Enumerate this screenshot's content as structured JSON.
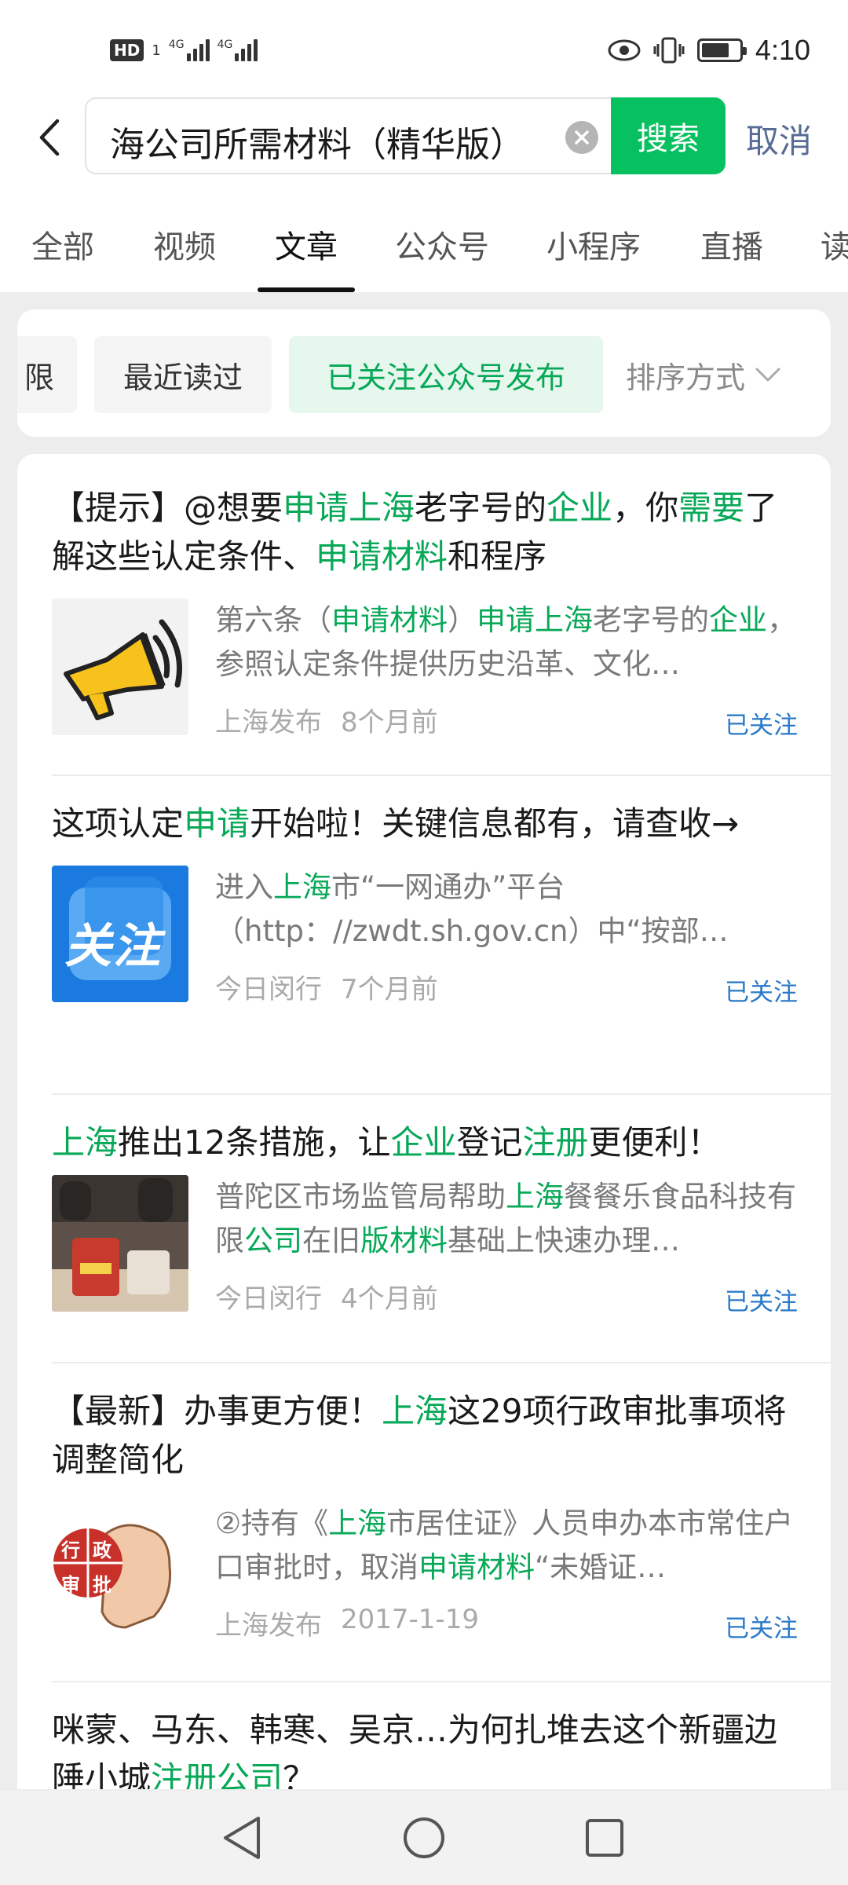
{
  "status_bar": {
    "badge": "HD",
    "sim": "1",
    "net1": "4G",
    "net2": "4G",
    "time": "4:10",
    "battery_level": 0.75
  },
  "search": {
    "query": "海公司所需材料（精华版）",
    "search_label": "搜索",
    "cancel_label": "取消"
  },
  "tabs": [
    "全部",
    "视频",
    "文章",
    "公众号",
    "小程序",
    "直播",
    "读"
  ],
  "active_tab": "文章",
  "filters": {
    "chip_partial": "限",
    "chip_recent": "最近读过",
    "chip_followed": "已关注公众号发布",
    "sort_label": "排序方式"
  },
  "results": [
    {
      "title_parts": [
        "【提示】@想要",
        "申请上海",
        "老字号的",
        "企业",
        "，你",
        "需要",
        "了解这些认定条件、",
        "申请材料",
        "和程序"
      ],
      "snippet_parts": [
        "第六条（",
        "申请材料",
        "）",
        "申请上海",
        "老字号的",
        "企业",
        "，参照认定条件提供历史沿革、文化…"
      ],
      "source": "上海发布",
      "time": "8个月前",
      "follow": "已关注",
      "thumb_icon": "megaphone-icon"
    },
    {
      "title_parts": [
        "这项认定",
        "申请",
        "开始啦！关键信息都有，请查收→"
      ],
      "snippet_parts": [
        "进入",
        "上海",
        "市“一网通办”平台（http：//zwdt.sh.gov.cn）中“按部…"
      ],
      "source": "今日闵行",
      "time": "7个月前",
      "follow": "已关注",
      "thumb_text": "关注"
    },
    {
      "title_parts": [
        "上海",
        "推出12条措施，让",
        "企业",
        "登记",
        "注册",
        "更便利！"
      ],
      "snippet_parts": [
        "普陀区市场监管局帮助",
        "上海",
        "餐餐乐食品科技有限",
        "公司",
        "在旧",
        "版材料",
        "基础上快速办理…"
      ],
      "source": "今日闵行",
      "time": "4个月前",
      "follow": "已关注",
      "thumb_icon": "food-photo"
    },
    {
      "title_parts": [
        "【最新】办事更方便！",
        "上海",
        "这29项行政审批事项将调整简化"
      ],
      "snippet_parts": [
        "②持有《",
        "上海",
        "市居住证》人员申办本市常住户口审批时，取消",
        "申请材料",
        "“未婚证…"
      ],
      "source": "上海发布",
      "time": "2017-1-19",
      "follow": "已关注",
      "thumb_chars": [
        "行",
        "政",
        "审",
        "批"
      ]
    },
    {
      "title_parts": [
        "咪蒙、马东、韩寒、吴京…为何扎堆去这个新疆边陲小城",
        "注册公司",
        "？"
      ]
    }
  ],
  "colors": {
    "accent": "#07c160",
    "highlight": "#07a857",
    "link": "#576b95",
    "follow": "#2a7ac8"
  }
}
